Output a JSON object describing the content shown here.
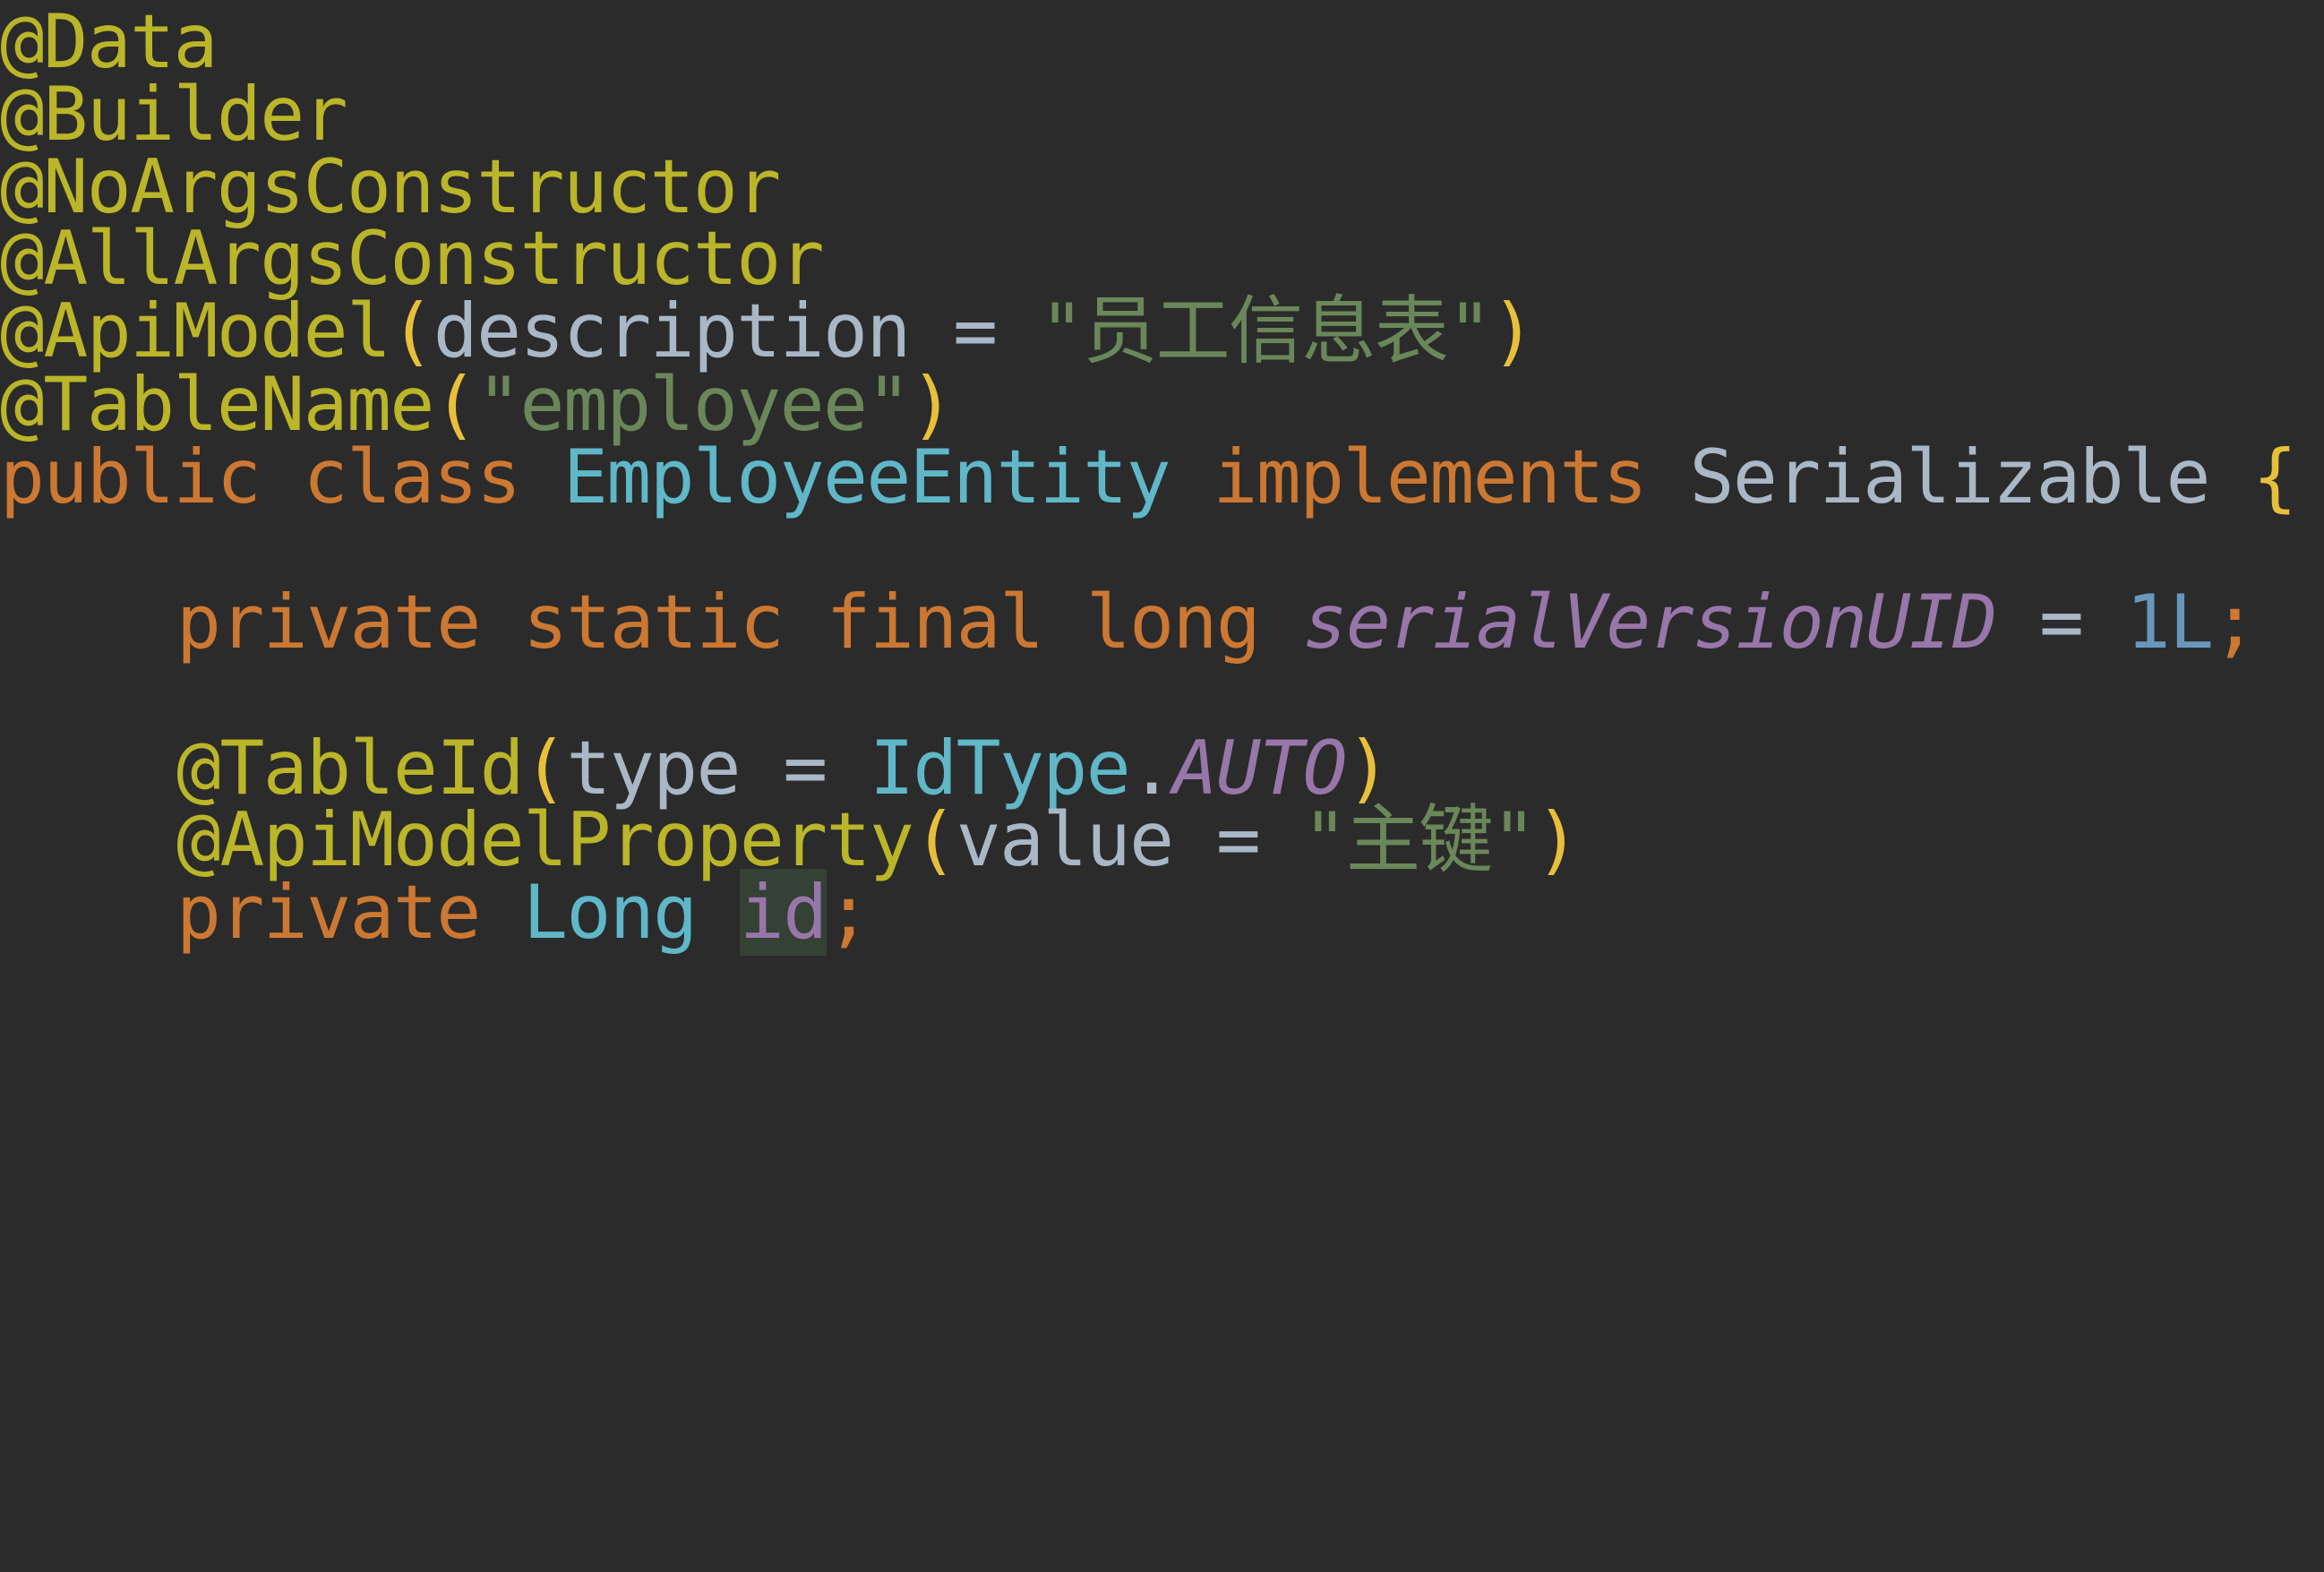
{
  "code": {
    "lines": [
      {
        "tokens": [
          {
            "t": "@Data",
            "c": "ann"
          }
        ]
      },
      {
        "tokens": [
          {
            "t": "@Builder",
            "c": "ann"
          }
        ]
      },
      {
        "tokens": [
          {
            "t": "@NoArgsConstructor",
            "c": "ann"
          }
        ]
      },
      {
        "tokens": [
          {
            "t": "@AllArgsConstructor",
            "c": "ann"
          }
        ]
      },
      {
        "tokens": [
          {
            "t": "@ApiModel",
            "c": "ann"
          },
          {
            "t": "(",
            "c": "paren"
          },
          {
            "t": "description = ",
            "c": "plain"
          },
          {
            "t": "\"员工信息表\"",
            "c": "str"
          },
          {
            "t": ")",
            "c": "paren"
          }
        ]
      },
      {
        "tokens": [
          {
            "t": "@TableName",
            "c": "ann"
          },
          {
            "t": "(",
            "c": "paren"
          },
          {
            "t": "\"employee\"",
            "c": "str"
          },
          {
            "t": ")",
            "c": "paren"
          }
        ]
      },
      {
        "tokens": [
          {
            "t": "public class ",
            "c": "kw"
          },
          {
            "t": "EmployeeEntity ",
            "c": "cls"
          },
          {
            "t": "implements ",
            "c": "kw"
          },
          {
            "t": "Serializable ",
            "c": "plain"
          },
          {
            "t": "{",
            "c": "paren"
          }
        ]
      },
      {
        "tokens": []
      },
      {
        "indent": true,
        "tokens": [
          {
            "t": "private static final long ",
            "c": "kw"
          },
          {
            "t": "serialVersionUID",
            "c": "field-i"
          },
          {
            "t": " = ",
            "c": "plain"
          },
          {
            "t": "1L",
            "c": "num"
          },
          {
            "t": ";",
            "c": "kw"
          }
        ]
      },
      {
        "tokens": []
      },
      {
        "indent": true,
        "tokens": [
          {
            "t": "@TableId",
            "c": "ann"
          },
          {
            "t": "(",
            "c": "paren"
          },
          {
            "t": "type = ",
            "c": "plain"
          },
          {
            "t": "IdType",
            "c": "cls"
          },
          {
            "t": ".",
            "c": "plain"
          },
          {
            "t": "AUTO",
            "c": "field-i"
          },
          {
            "t": ")",
            "c": "paren"
          }
        ]
      },
      {
        "indent": true,
        "tokens": [
          {
            "t": "@ApiModelProperty",
            "c": "ann"
          },
          {
            "t": "(",
            "c": "paren"
          },
          {
            "t": "value = ",
            "c": "plain"
          },
          {
            "t": "\"主键\"",
            "c": "str"
          },
          {
            "t": ")",
            "c": "paren"
          }
        ]
      },
      {
        "indent": true,
        "tokens": [
          {
            "t": "private ",
            "c": "kw"
          },
          {
            "t": "Long ",
            "c": "cls"
          },
          {
            "t": "id",
            "c": "field hl"
          },
          {
            "t": ";",
            "c": "kw"
          }
        ]
      }
    ]
  },
  "colors": {
    "background": "#2b2b2b",
    "annotation": "#bbb529",
    "keyword": "#cc7832",
    "class": "#5fb7c8",
    "plain": "#a9b7c6",
    "string": "#6a8759",
    "paren": "#e8bf3a",
    "number": "#6897bb",
    "field": "#9876aa"
  }
}
